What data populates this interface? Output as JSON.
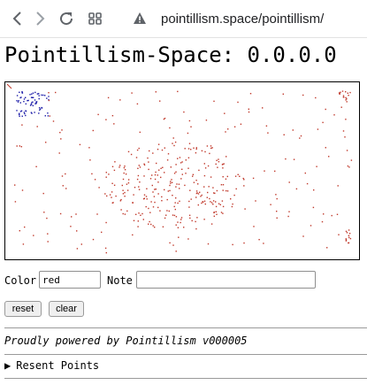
{
  "browser": {
    "url": "pointillism.space/pointillism/",
    "icons": [
      "back-icon",
      "forward-icon",
      "reload-icon",
      "tabs-grid-icon",
      "not-secure-warning-icon"
    ]
  },
  "page": {
    "title": "Pointillism-Space: 0.0.0.0"
  },
  "controls": {
    "color_label": "Color",
    "color_value": "red",
    "note_label": "Note",
    "note_value": "",
    "reset_label": "reset",
    "clear_label": "clear"
  },
  "footer": {
    "powered_by": "Proudly powered by Pointillism v000005"
  },
  "details": {
    "summary_label": "Resent Points",
    "expanded": false
  },
  "colors": {
    "dot_red": "#c0392b",
    "dot_blue": "#1a1aa8",
    "warning": "#5f6368"
  }
}
